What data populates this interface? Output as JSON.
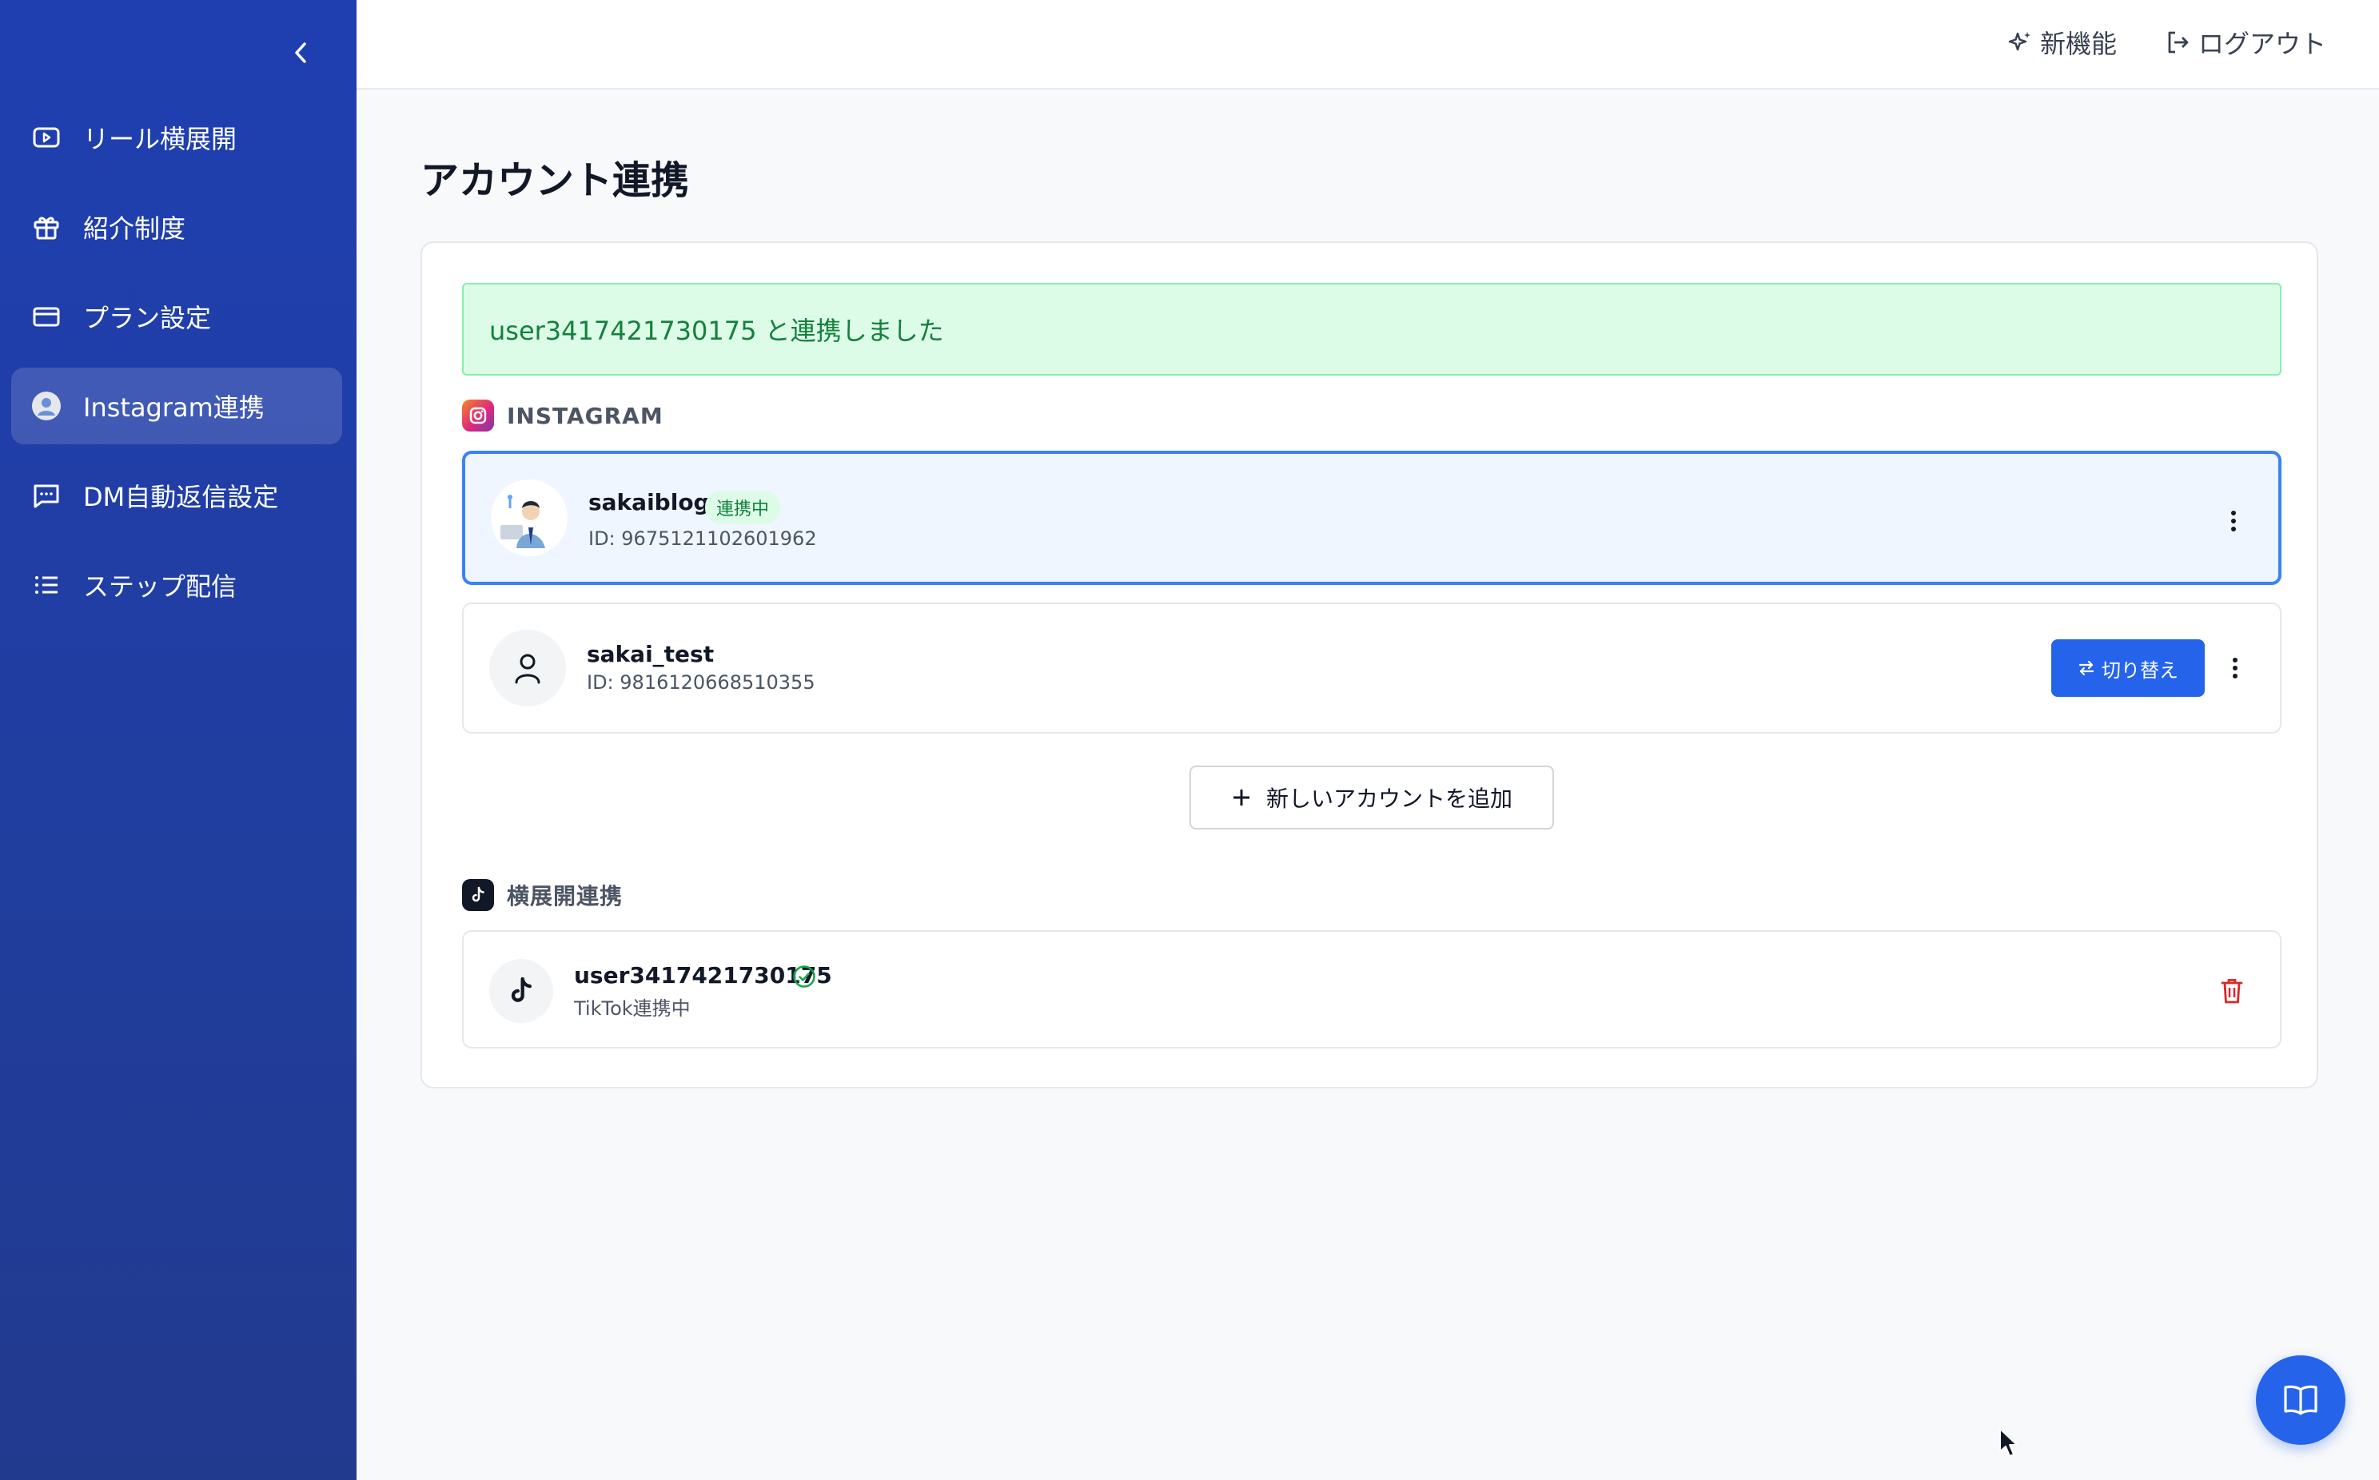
{
  "sidebar": {
    "collapse_icon": "chevron-left-icon",
    "items": [
      {
        "label": "リール横展開",
        "icon": "video-play-icon"
      },
      {
        "label": "紹介制度",
        "icon": "gift-icon"
      },
      {
        "label": "プラン設定",
        "icon": "credit-card-icon"
      },
      {
        "label": "Instagram連携",
        "icon": "avatar-icon",
        "active": true
      },
      {
        "label": "DM自動返信設定",
        "icon": "chat-icon"
      },
      {
        "label": "ステップ配信",
        "icon": "list-icon"
      }
    ]
  },
  "header": {
    "new_features": "新機能",
    "logout": "ログアウト"
  },
  "page": {
    "title": "アカウント連携"
  },
  "alert": {
    "message": "user3417421730175 と連携しました"
  },
  "instagram": {
    "section_label": "INSTAGRAM",
    "accounts": [
      {
        "name": "sakaiblog",
        "badge": "連携中",
        "id": "ID: 9675121102601962",
        "selected": true
      },
      {
        "name": "sakai_test",
        "id": "ID: 9816120668510355",
        "switch_label": "切り替え"
      }
    ],
    "add_label": "新しいアカウントを追加"
  },
  "crosspost": {
    "section_label": "横展開連携",
    "account": {
      "name": "user3417421730175",
      "status": "TikTok連携中"
    }
  },
  "colors": {
    "sidebar": "#1f3fb1",
    "primary": "#2563eb",
    "success": "#15803d",
    "danger": "#dc2626"
  }
}
